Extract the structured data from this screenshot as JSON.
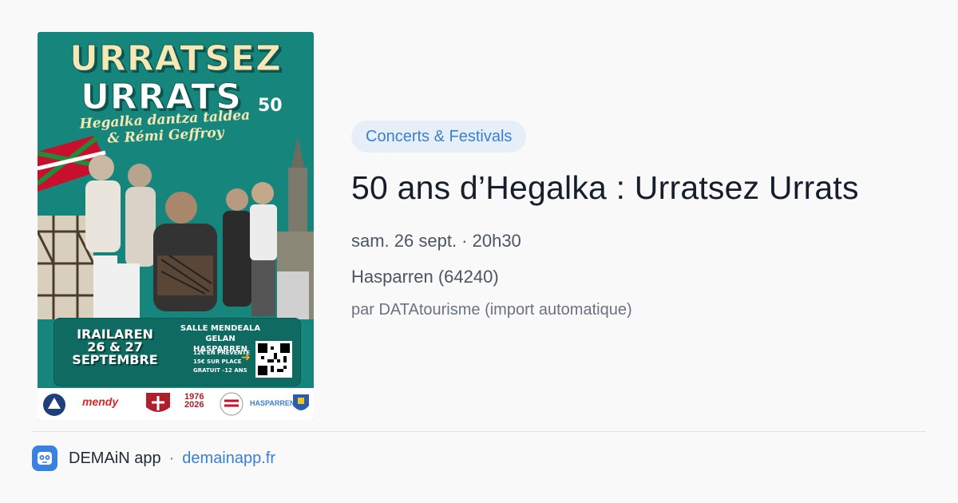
{
  "poster": {
    "title_line1": "URRATSEZ",
    "title_line2": "URRATS",
    "badge": "50",
    "subtitle_line1": "Hegalka dantza taldea",
    "subtitle_line2": "& Rémi Geffroy",
    "dates_line1": "IRAILAREN",
    "dates_line2": "26 & 27",
    "dates_line3": "SEPTEMBRE",
    "venue_line1": "SALLE MENDEALA GELAN",
    "venue_line2": "HASPARREN",
    "price1": "12€ EN PRÉVENTE",
    "price2": "15€ SUR PLACE",
    "price3": "GRATUIT -12 ANS",
    "logo_mendy": "mendy",
    "logo_years_1": "1976",
    "logo_years_2": "2026",
    "logo_hasparren": "HASPARREN"
  },
  "event": {
    "category": "Concerts & Festivals",
    "title": "50 ans d’Hegalka : Urratsez Urrats",
    "date": "sam. 26 sept. · 20h30",
    "location": "Hasparren (64240)",
    "source": "par DATAtourisme (import automatique)"
  },
  "footer": {
    "app_name": "DEMAiN app",
    "separator": "·",
    "link": "demainapp.fr"
  },
  "colors": {
    "poster_bg": "#16867c",
    "accent": "#3a7fd4",
    "chip_bg": "#e6eef8"
  }
}
